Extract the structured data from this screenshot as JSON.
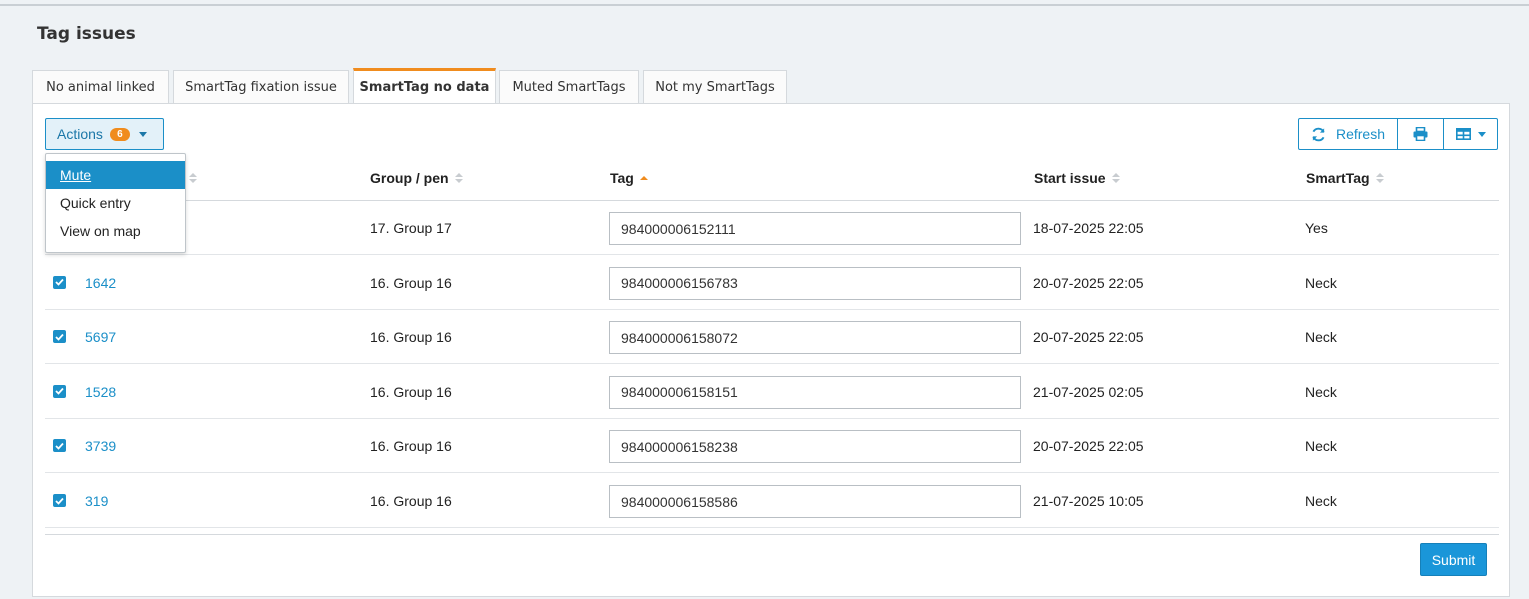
{
  "page": {
    "title": "Tag issues"
  },
  "tabs": [
    {
      "label": "No animal linked"
    },
    {
      "label": "SmartTag fixation issue"
    },
    {
      "label": "SmartTag no data",
      "active": true
    },
    {
      "label": "Muted SmartTags"
    },
    {
      "label": "Not my SmartTags"
    }
  ],
  "toolbar": {
    "actions_label": "Actions",
    "actions_count": "6",
    "refresh_label": "Refresh",
    "print_icon": "printer-icon",
    "columns_icon": "table-columns-icon"
  },
  "dropdown": {
    "items": [
      {
        "label": "Mute",
        "highlighted": true
      },
      {
        "label": "Quick entry"
      },
      {
        "label": "View on map"
      }
    ]
  },
  "table": {
    "headers": {
      "animal": "r",
      "group": "Group / pen",
      "tag": "Tag",
      "start": "Start issue",
      "smarttag": "SmartTag"
    },
    "sorted_column": "tag",
    "rows": [
      {
        "checked": true,
        "animal": "",
        "group": "17. Group 17",
        "tag": "984000006152111",
        "start": "18-07-2025 22:05",
        "smarttag": "Yes"
      },
      {
        "checked": true,
        "animal": "1642",
        "group": "16. Group 16",
        "tag": "984000006156783",
        "start": "20-07-2025 22:05",
        "smarttag": "Neck"
      },
      {
        "checked": true,
        "animal": "5697",
        "group": "16. Group 16",
        "tag": "984000006158072",
        "start": "20-07-2025 22:05",
        "smarttag": "Neck"
      },
      {
        "checked": true,
        "animal": "1528",
        "group": "16. Group 16",
        "tag": "984000006158151",
        "start": "21-07-2025 02:05",
        "smarttag": "Neck"
      },
      {
        "checked": true,
        "animal": "3739",
        "group": "16. Group 16",
        "tag": "984000006158238",
        "start": "20-07-2025 22:05",
        "smarttag": "Neck"
      },
      {
        "checked": true,
        "animal": "319",
        "group": "16. Group 16",
        "tag": "984000006158586",
        "start": "21-07-2025 10:05",
        "smarttag": "Neck"
      }
    ]
  },
  "footer": {
    "submit_label": "Submit"
  },
  "colors": {
    "accent": "#1b8fc8",
    "active_tab": "#f08c1e",
    "badge": "#f08c1e"
  }
}
